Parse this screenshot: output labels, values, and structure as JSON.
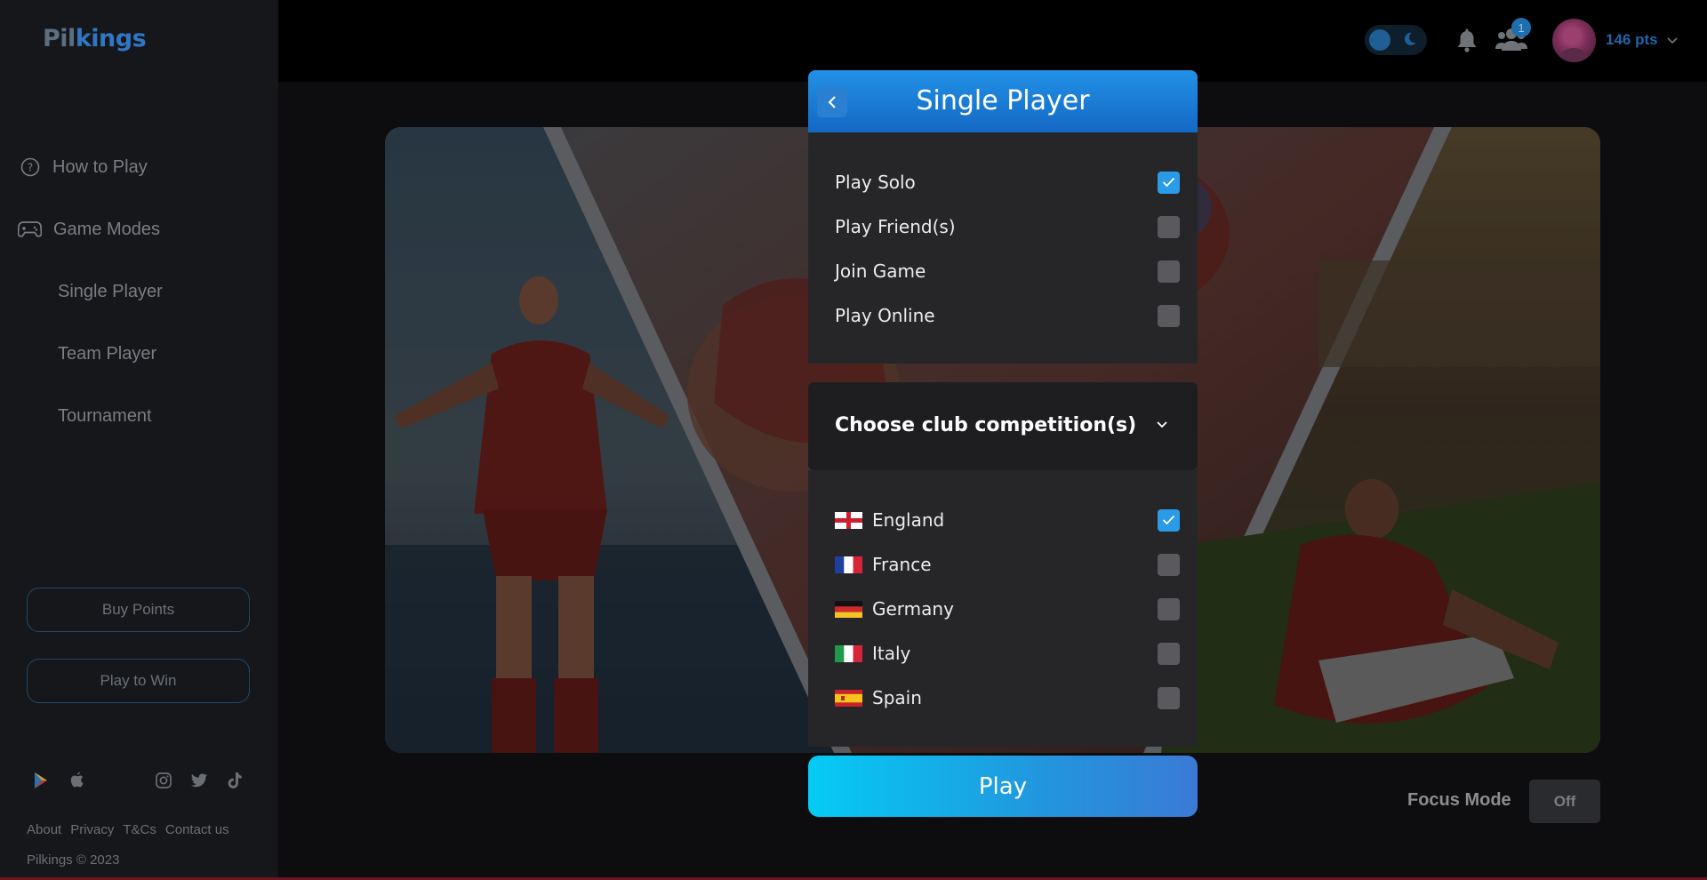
{
  "brand": {
    "part1": "Pil",
    "part2": "kings"
  },
  "sidebar": {
    "nav": [
      {
        "label": "How to Play",
        "icon": "question-circle-icon"
      },
      {
        "label": "Game Modes",
        "icon": "gamepad-icon"
      }
    ],
    "modes": [
      "Single Player",
      "Team Player",
      "Tournament"
    ],
    "buttons": {
      "buy": "Buy Points",
      "win": "Play to Win"
    },
    "footer_links": [
      "About",
      "Privacy",
      "T&Cs",
      "Contact us"
    ],
    "copyright": "Pilkings © 2023"
  },
  "topbar": {
    "friend_badge": "1",
    "points": "146 pts"
  },
  "modal": {
    "title": "Single Player",
    "options": [
      {
        "label": "Play Solo",
        "checked": true
      },
      {
        "label": "Play Friend(s)",
        "checked": false
      },
      {
        "label": "Join Game",
        "checked": false
      },
      {
        "label": "Play Online",
        "checked": false
      }
    ],
    "competition_title": "Choose club competition(s)",
    "countries": [
      {
        "label": "England",
        "checked": true,
        "flag": "flag-england-icon"
      },
      {
        "label": "France",
        "checked": false,
        "flag": "flag-france-icon"
      },
      {
        "label": "Germany",
        "checked": false,
        "flag": "flag-germany-icon"
      },
      {
        "label": "Italy",
        "checked": false,
        "flag": "flag-italy-icon"
      },
      {
        "label": "Spain",
        "checked": false,
        "flag": "flag-spain-icon"
      }
    ],
    "play_label": "Play"
  },
  "focus": {
    "label": "Focus Mode",
    "value": "Off"
  },
  "colors": {
    "accent": "#2291e6",
    "play_start": "#05cbf5",
    "play_end": "#3a7ad6",
    "checked": "#2b9be8"
  }
}
